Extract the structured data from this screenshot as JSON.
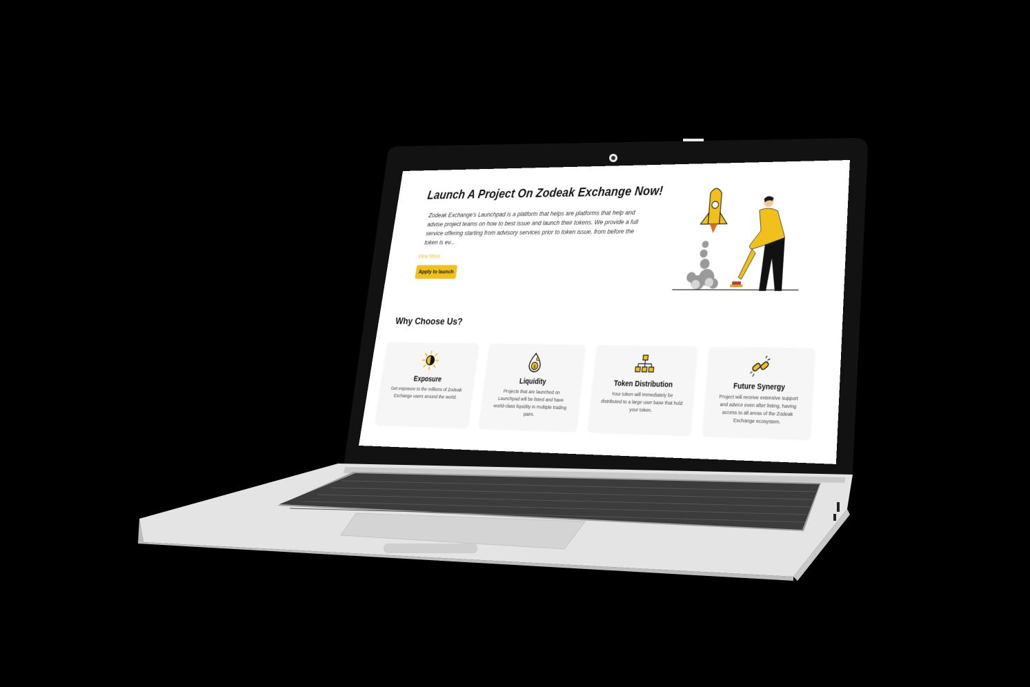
{
  "hero": {
    "title": "Launch A Project On Zodeak Exchange Now!",
    "description": "Zodeak Exchange's Launchpad is a platform that helps are platforms that help and advise project teams on how to best issue and launch their tokens. We provide a full service offering starting from advisory services prior to token issue, from before the token is ev...",
    "view_more": "View More",
    "apply_button": "Apply to launch"
  },
  "why": {
    "title": "Why Choose Us?",
    "cards": [
      {
        "title": "Exposure",
        "text": "Get exposure to the millions of Zodeak Exchange users around the world.",
        "icon": "sun-icon"
      },
      {
        "title": "Liquidity",
        "text": "Projects that are launched on Launchpad will be listed and have world-class liquidity in multiple trading pairs.",
        "icon": "coin-drop-icon"
      },
      {
        "title": "Token Distribution",
        "text": "Your token will immediately be distributed to a large user base that hold your token.",
        "icon": "network-boxes-icon"
      },
      {
        "title": "Future Synergy",
        "text": "Project will receive extensive support and advice even after listing, having access to all areas of the Zodeak Exchange ecosystem.",
        "icon": "link-chain-icon"
      }
    ]
  },
  "colors": {
    "accent": "#f2c01c",
    "bezel": "#111111",
    "body": "#d9d9d9"
  }
}
